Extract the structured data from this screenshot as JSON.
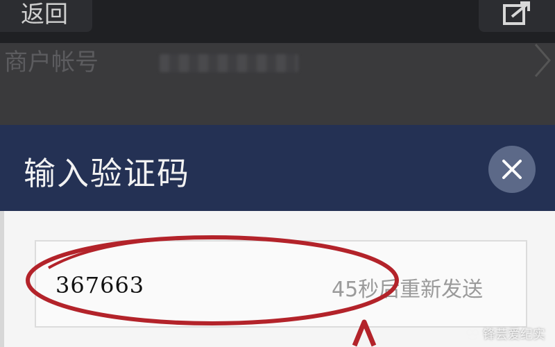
{
  "topbar": {
    "back_label": "返回",
    "share_icon": "share-icon"
  },
  "account": {
    "label": "商户帐号",
    "value_masked": true
  },
  "dialog": {
    "title": "输入验证码",
    "close_icon": "close-icon",
    "code_value": "367663",
    "resend_label": "45秒后重新发送"
  },
  "annotation": {
    "highlight_color": "#b3232a"
  },
  "watermark": {
    "text": "锋芸爱纪实"
  },
  "colors": {
    "header": "#243154",
    "close_button": "#5c6988",
    "body": "#f5f5f5"
  }
}
